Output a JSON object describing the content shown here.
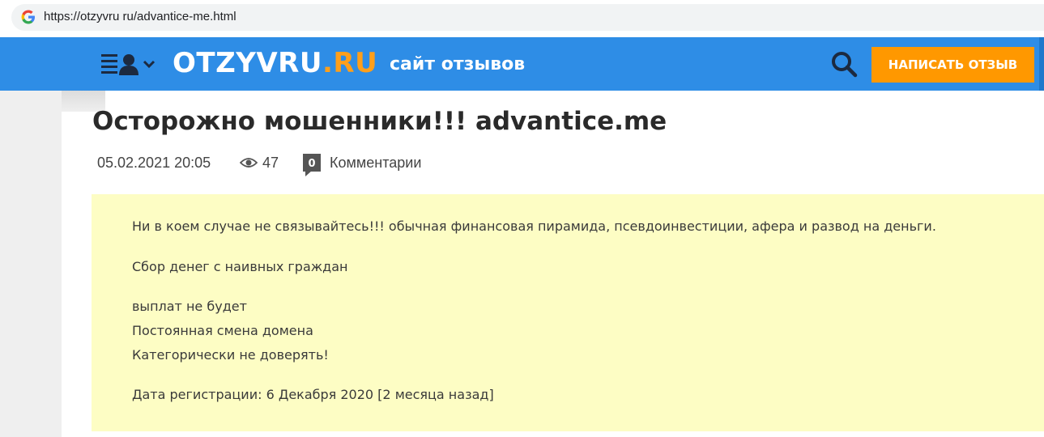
{
  "browser": {
    "url": "https://otzyvru ru/advantice-me.html"
  },
  "header": {
    "logo_main": "OTZYVRU",
    "logo_accent": ".RU",
    "tagline": "сайт отзывов",
    "write_review_label": "НАПИСАТЬ ОТЗЫВ",
    "icons": [
      "menu-user-icon",
      "search-icon"
    ]
  },
  "article": {
    "title": "Осторожно мошенники!!! advantice.me",
    "date": "05.02.2021 20:05",
    "views": "47",
    "comments_count": "0",
    "comments_label": "Комментарии",
    "paragraphs": [
      "Ни в коем случае не связывайтесь!!! обычная финансовая пирамида, псевдоинвестиции, афера и развод на деньги.",
      "Сбор денег с наивных граждан",
      "выплат не будет",
      "Постоянная смена домена",
      "Категорически не доверять!",
      "Дата регистрации: 6 Декабря 2020 [2 месяца назад]"
    ]
  },
  "colors": {
    "header_bg": "#2e8de6",
    "accent_orange": "#ff9800",
    "review_bg": "#fdfdc4"
  }
}
